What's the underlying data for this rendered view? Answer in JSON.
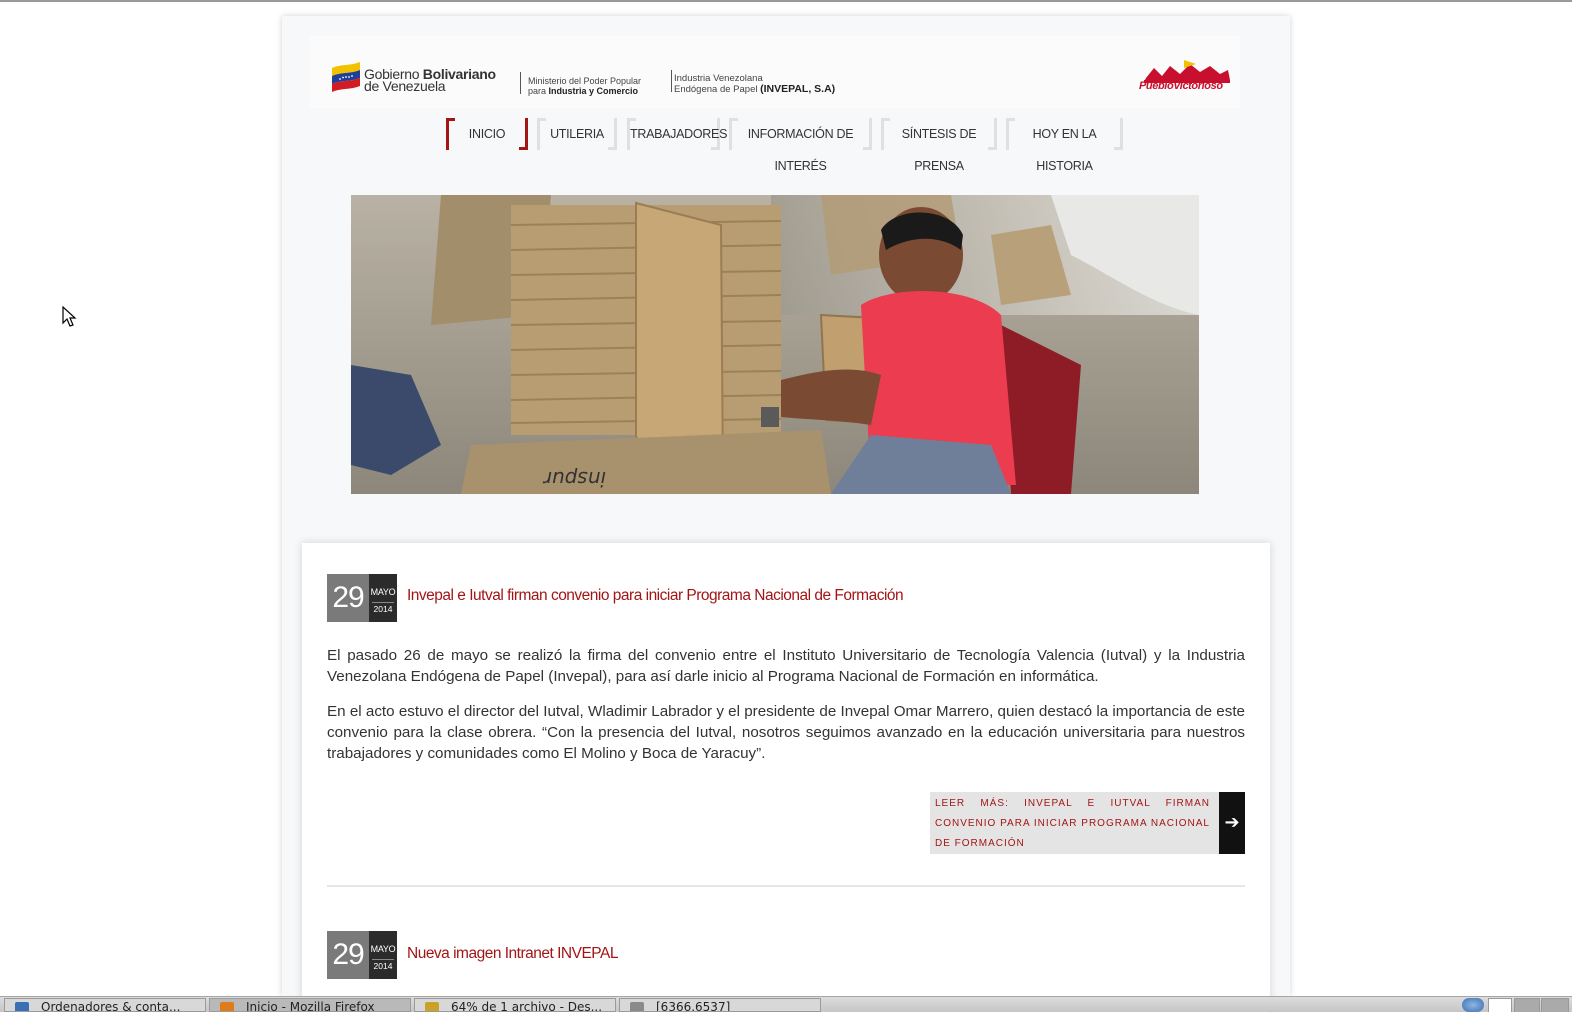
{
  "banner": {
    "gov_line1_pre": "Gobierno ",
    "gov_line1_bold": "Bolivariano",
    "gov_line2": "de Venezuela",
    "ministry_line1": "Ministerio del Poder Popular",
    "ministry_line2_pre": "para ",
    "ministry_line2_bold": "Industria y Comercio",
    "company_line1": "Industria Venezolana",
    "company_line2_pre": "Endógena de Papel ",
    "company_line2_bold": "(INVEPAL, S.A)",
    "slogan": "PuebloVictorioso"
  },
  "nav": {
    "items": [
      {
        "label": "INICIO",
        "active": true
      },
      {
        "label": "UTILERIA",
        "active": false
      },
      {
        "label": "TRABAJADORES",
        "active": false
      },
      {
        "label": "INFORMACIÓN DE INTERÉS",
        "active": false
      },
      {
        "label": "SÍNTESIS DE PRENSA",
        "active": false
      },
      {
        "label": "HOY EN LA HISTORIA",
        "active": false
      }
    ]
  },
  "hero": {
    "box_text": "inspur"
  },
  "posts": [
    {
      "day": "29",
      "month": "MAYO",
      "year": "2014",
      "title": "Invepal e Iutval firman convenio para iniciar Programa Nacional de Formación",
      "paragraphs": [
        "El pasado 26 de mayo se realizó la firma del convenio entre el Instituto Universitario de Tecnología Valencia (Iutval) y la Industria Venezolana Endógena de Papel (Invepal), para así darle inicio al Programa Nacional de Formación en informática.",
        "En el acto estuvo el director del Iutval, Wladimir Labrador y el presidente de Invepal Omar Marrero, quien destacó la importancia de este convenio para la clase obrera. “Con la presencia del Iutval, nosotros seguimos avanzado en la educación universitaria para nuestros trabajadores y comunidades como El Molino y Boca de Yaracuy”."
      ],
      "read_more": "LEER MÁS: INVEPAL E IUTVAL FIRMAN CONVENIO PARA INICIAR PROGRAMA NACIONAL DE FORMACIÓN",
      "read_more_arrow": "➔"
    },
    {
      "day": "29",
      "month": "MAYO",
      "year": "2014",
      "title": "Nueva imagen Intranet INVEPAL"
    }
  ],
  "taskbar": {
    "tasks": [
      {
        "label": "Ordenadores & conta...",
        "icon_color": "#3a6fb5",
        "active": false
      },
      {
        "label": "Inicio - Mozilla Firefox",
        "icon_color": "#e07b1a",
        "active": true
      },
      {
        "label": "64% de 1 archivo - Des...",
        "icon_color": "#c9a227",
        "active": false
      },
      {
        "label": "[6366.6537]",
        "icon_color": "#8a8a8a",
        "active": false
      }
    ]
  },
  "colors": {
    "accent": "#a31515",
    "date_day_bg": "#7a7a7a",
    "date_month_bg": "#2b2b2b",
    "readmore_bg": "#e4e4e4"
  },
  "icons": [
    "venezuela-flag-logo",
    "pueblo-victorioso-logo",
    "arrow-right-icon",
    "mouse-cursor-icon"
  ]
}
